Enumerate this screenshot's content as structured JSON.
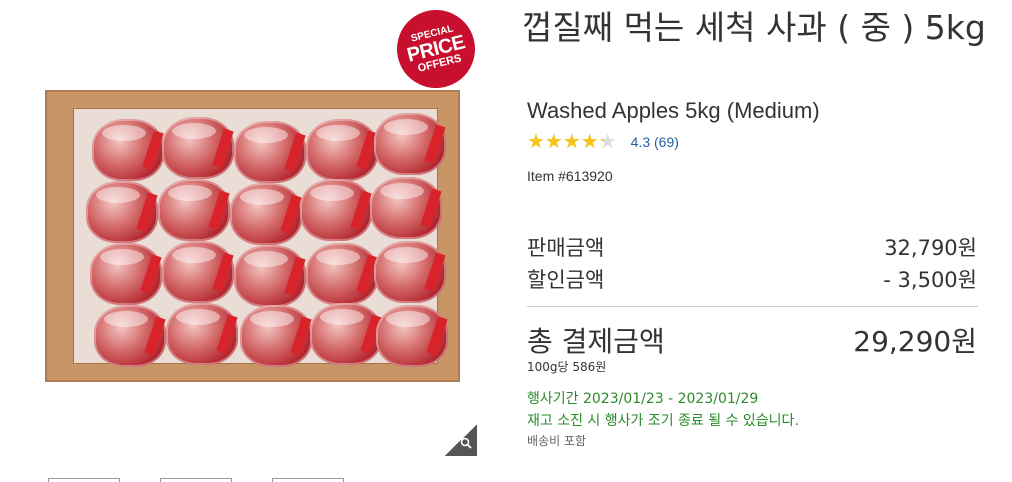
{
  "product": {
    "title_ko": "껍질째 먹는 세척 사과 ( 중 ) 5kg",
    "title_en": "Washed Apples 5kg (Medium)",
    "rating_value": 4.3,
    "rating_text": "4.3",
    "review_count": "(69)",
    "stars_glyphs": "★★★★★",
    "item_number": "Item #613920"
  },
  "badge": {
    "line1": "SPECIAL",
    "line2": "PRICE",
    "line3": "OFFERS",
    "color": "#c8102e"
  },
  "pricing": {
    "sale_label": "판매금액",
    "sale_value": "32,790원",
    "discount_label": "할인금액",
    "discount_value": "- 3,500원",
    "total_label": "총 결제금액",
    "total_value": "29,290원",
    "unit_price": "100g당 586원"
  },
  "promotion": {
    "period": "행사기간 2023/01/23 - 2023/01/29",
    "note": "재고 소진 시 행사가 조기 종료 될 수 있습니다.",
    "color": "#2a8a2a"
  },
  "shipping": {
    "label": "배송비 포함"
  },
  "icons": {
    "zoom": "magnifier-icon",
    "rating": "star-icon"
  },
  "colors": {
    "link": "#1f5fa8",
    "star": "#f5c518",
    "text": "#333333"
  }
}
